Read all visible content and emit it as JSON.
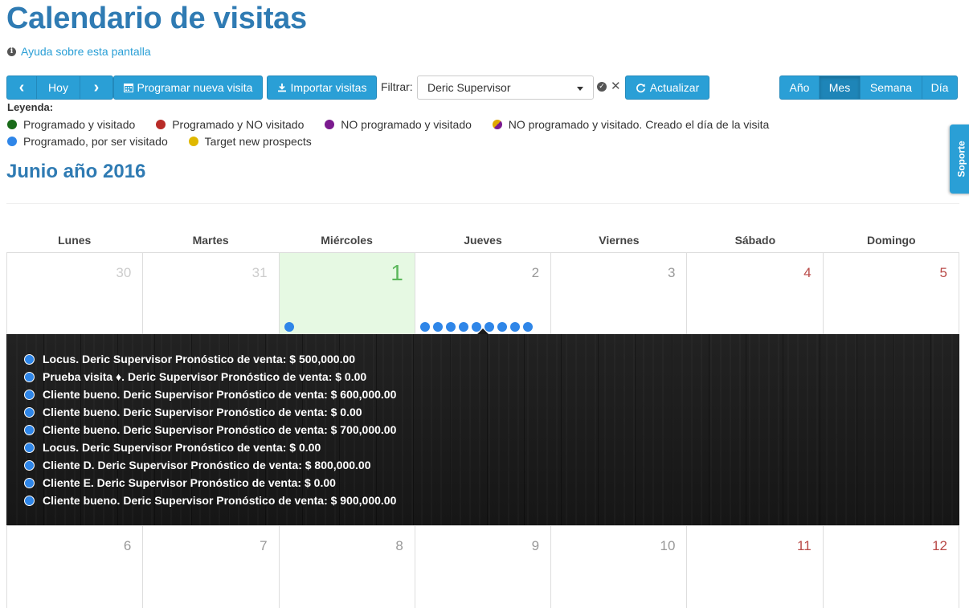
{
  "page_title": "Calendario de visitas",
  "help": {
    "info_glyph": "i",
    "link_text": "Ayuda sobre esta pantalla"
  },
  "toolbar": {
    "prev_glyph": "‹",
    "today_label": "Hoy",
    "next_glyph": "›",
    "schedule_label": "Programar nueva visita",
    "import_label": "Importar visitas",
    "filter_label": "Filtrar:",
    "filter_value": "Deric Supervisor",
    "refresh_label": "Actualizar",
    "views": [
      "Año",
      "Mes",
      "Semana",
      "Día"
    ],
    "active_view": "Mes"
  },
  "legend": {
    "title": "Leyenda:",
    "items": [
      {
        "label": "Programado y visitado",
        "color": "#1a6b1a"
      },
      {
        "label": "Programado y NO visitado",
        "color": "#b92c28"
      },
      {
        "label": "NO programado y visitado",
        "color": "#7b1a8f"
      },
      {
        "label": "NO programado y visitado. Creado el día de la visita",
        "color": "split"
      },
      {
        "label": "Programado, por ser visitado",
        "color": "#2f86e8"
      },
      {
        "label": "Target new prospects",
        "color": "#e0b800"
      }
    ]
  },
  "support_tab": "Soporte",
  "month_title": "Junio año 2016",
  "weekdays": [
    "Lunes",
    "Martes",
    "Miércoles",
    "Jueves",
    "Viernes",
    "Sábado",
    "Domingo"
  ],
  "week1": [
    {
      "day": "30",
      "state": "muted",
      "events": 0
    },
    {
      "day": "31",
      "state": "muted",
      "events": 0
    },
    {
      "day": "1",
      "state": "today",
      "events": 1
    },
    {
      "day": "2",
      "state": "normal",
      "events": 9
    },
    {
      "day": "3",
      "state": "normal",
      "events": 0
    },
    {
      "day": "4",
      "state": "weekend",
      "events": 0
    },
    {
      "day": "5",
      "state": "weekend",
      "events": 0
    }
  ],
  "week2": [
    {
      "day": "6",
      "state": "normal"
    },
    {
      "day": "7",
      "state": "normal"
    },
    {
      "day": "8",
      "state": "normal"
    },
    {
      "day": "9",
      "state": "normal"
    },
    {
      "day": "10",
      "state": "normal"
    },
    {
      "day": "11",
      "state": "weekend"
    },
    {
      "day": "12",
      "state": "weekend"
    }
  ],
  "events_panel": [
    "Locus. Deric Supervisor Pronóstico de venta: $ 500,000.00",
    "Prueba visita ♦. Deric Supervisor Pronóstico de venta: $ 0.00",
    "Cliente bueno. Deric Supervisor Pronóstico de venta: $ 600,000.00",
    "Cliente bueno. Deric Supervisor Pronóstico de venta: $ 0.00",
    "Cliente bueno. Deric Supervisor Pronóstico de venta: $ 700,000.00",
    "Locus. Deric Supervisor Pronóstico de venta: $ 0.00",
    "Cliente D. Deric Supervisor Pronóstico de venta: $ 800,000.00",
    "Cliente E. Deric Supervisor Pronóstico de venta: $ 0.00",
    "Cliente bueno. Deric Supervisor Pronóstico de venta: $ 900,000.00"
  ]
}
